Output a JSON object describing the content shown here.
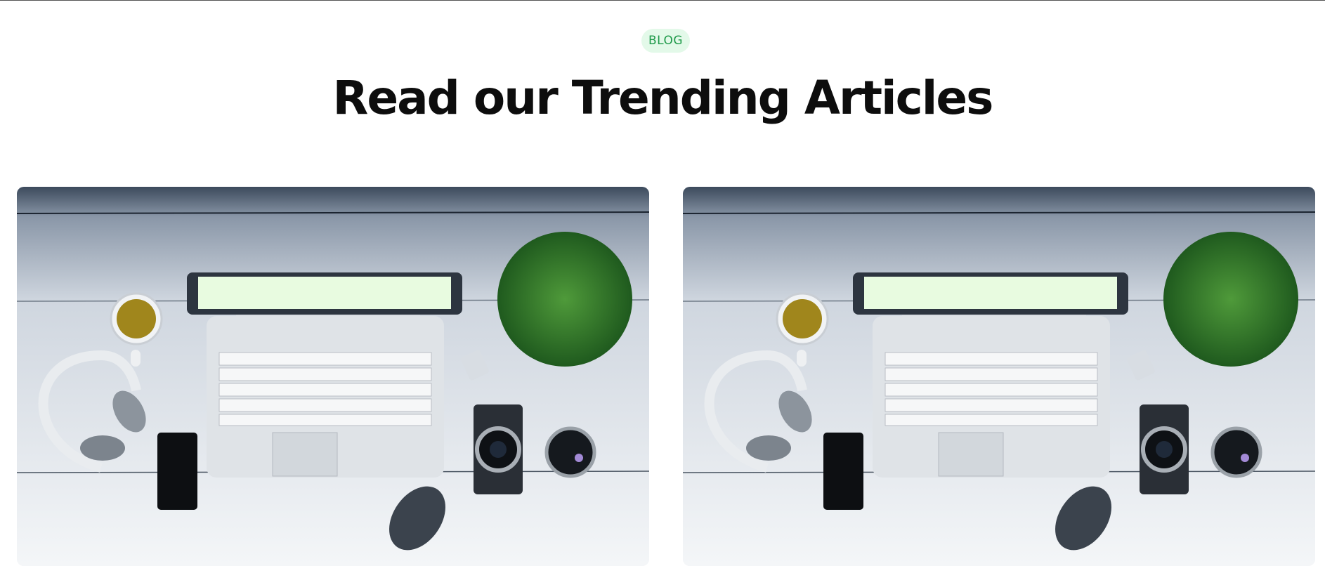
{
  "header": {
    "badge_label": "BLOG",
    "title": "Read our Trending Articles"
  },
  "articles": [
    {
      "image_subject": "desk-workspace-photo"
    },
    {
      "image_subject": "desk-workspace-photo"
    }
  ],
  "colors": {
    "badge_bg": "#e3f9e9",
    "badge_text": "#1f9a4a",
    "title": "#0d0d0d"
  }
}
